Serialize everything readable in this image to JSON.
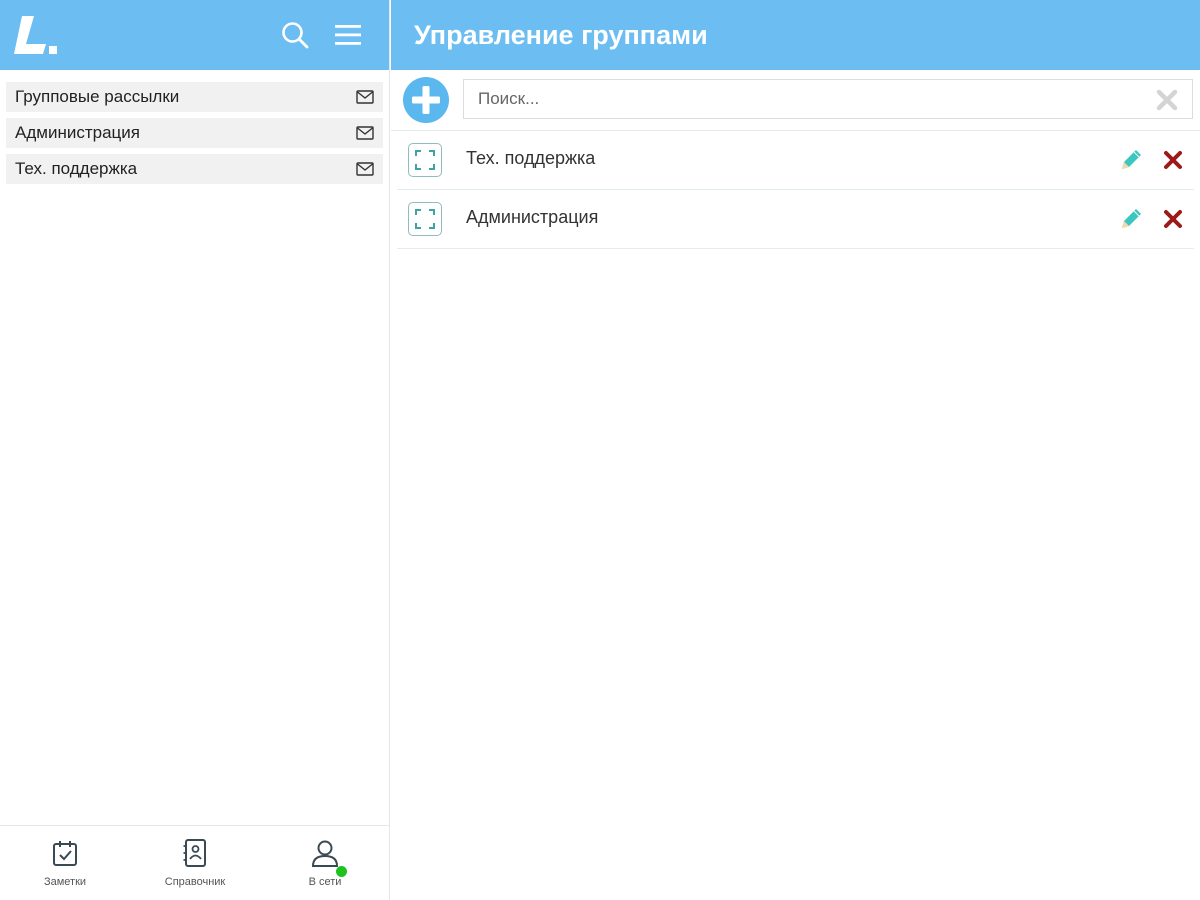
{
  "app": {
    "title": "Управление группами",
    "brand_color": "#6bbdf2",
    "logo_icon": "logo-l-icon"
  },
  "sidebar": {
    "header_icons": [
      "search-icon",
      "hamburger-menu-icon"
    ],
    "groups": [
      {
        "label": "Групповые рассылки",
        "icon": "envelope-icon"
      },
      {
        "label": "Администрация",
        "icon": "envelope-icon"
      },
      {
        "label": "Тех. поддержка",
        "icon": "envelope-icon"
      }
    ],
    "bottom_nav": [
      {
        "label": "Заметки",
        "icon": "calendar-check-icon"
      },
      {
        "label": "Справочник",
        "icon": "contact-book-icon"
      },
      {
        "label": "В сети",
        "icon": "user-icon",
        "status": "online",
        "status_color": "#1fc11f"
      }
    ]
  },
  "main": {
    "search": {
      "placeholder": "Поиск...",
      "value": ""
    },
    "rows": [
      {
        "label": "Тех. поддержка"
      },
      {
        "label": "Администрация"
      }
    ],
    "colors": {
      "edit": "#3cc6c0",
      "delete": "#9b1b1b"
    }
  }
}
